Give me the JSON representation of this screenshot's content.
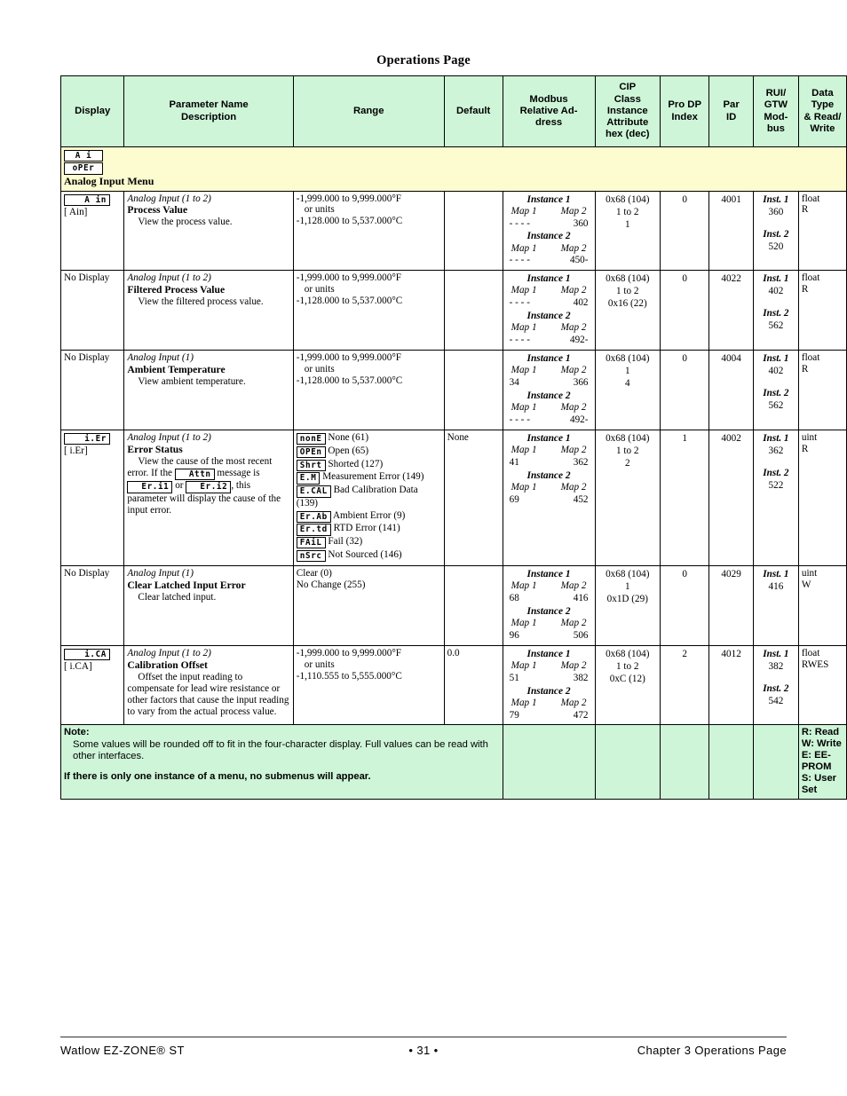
{
  "page_heading": "Operations Page",
  "table": {
    "headers": [
      "Display",
      "Parameter Name\nDescription",
      "Range",
      "Default",
      "Modbus\nRelative Address",
      "CIP\nClass\nInstance\nAttribute\nhex (dec)",
      "Pro DP\nIndex",
      "Par\nID",
      "RUI/\nGTW\nModbus",
      "Data\nType\n& Read/\nWrite"
    ],
    "header_parts": {
      "display": "Display",
      "param_1": "Parameter Name",
      "param_2": "Description",
      "range": "Range",
      "default": "Default",
      "modbus_1": "Modbus",
      "modbus_2": "Relative Ad-",
      "modbus_3": "dress",
      "cip_1": "CIP",
      "cip_2": "Class",
      "cip_3": "Instance",
      "cip_4": "Attribute",
      "cip_5": "hex (dec)",
      "prodp_1": "Pro DP",
      "prodp_2": "Index",
      "parid_1": "Par",
      "parid_2": "ID",
      "rui_1": "RUI/",
      "rui_2": "GTW",
      "rui_3": "Mod-",
      "rui_4": "bus",
      "dtype_1": "Data",
      "dtype_2": "Type",
      "dtype_3": "& Read/",
      "dtype_4": "Write"
    },
    "menu_row": {
      "seg_top": "A i",
      "seg_bottom": "oPEr",
      "title": "Analog Input Menu"
    },
    "rows": [
      {
        "display": {
          "seg": "A in",
          "bracket": "[ Ain]",
          "no_display": null
        },
        "param": {
          "instance": "Analog Input (1 to 2)",
          "name": "Process Value",
          "description": "View the process value."
        },
        "range": {
          "lines": [
            "-1,999.000 to 9,999.000°F",
            "or units",
            "-1,128.000 to 5,537.000°C"
          ],
          "indent": [
            false,
            true,
            false
          ]
        },
        "default": "",
        "modbus": {
          "inst1_label": "Instance 1",
          "map_header": [
            "Map 1",
            "Map 2"
          ],
          "inst1_vals": [
            "- - - -",
            "360"
          ],
          "inst2_label": "Instance 2",
          "inst2_vals": [
            "- - - -",
            "450-"
          ]
        },
        "cip": [
          "0x68 (104)",
          "1 to 2",
          "1"
        ],
        "prodp": "0",
        "parid": "4001",
        "rui": {
          "inst1_label": "Inst. 1",
          "inst1_value": "360",
          "inst2_label": "Inst. 2",
          "inst2_value": "520"
        },
        "dtype": [
          "float",
          "R"
        ]
      },
      {
        "display": {
          "seg": null,
          "bracket": null,
          "no_display": "No Display"
        },
        "param": {
          "instance": "Analog Input (1 to 2)",
          "name": "Filtered Process Value",
          "description": "View the filtered process value."
        },
        "range": {
          "lines": [
            "-1,999.000 to 9,999.000°F",
            "or units",
            "-1,128.000 to 5,537.000°C"
          ],
          "indent": [
            false,
            true,
            false
          ]
        },
        "default": "",
        "modbus": {
          "inst1_label": "Instance 1",
          "map_header": [
            "Map 1",
            "Map 2"
          ],
          "inst1_vals": [
            "- - - -",
            "402"
          ],
          "inst2_label": "Instance 2",
          "inst2_vals": [
            "- - - -",
            "492-"
          ]
        },
        "cip": [
          "0x68 (104)",
          "1 to 2",
          "0x16 (22)"
        ],
        "prodp": "0",
        "parid": "4022",
        "rui": {
          "inst1_label": "Inst. 1",
          "inst1_value": "402",
          "inst2_label": "Inst. 2",
          "inst2_value": "562"
        },
        "dtype": [
          "float",
          "R"
        ]
      },
      {
        "display": {
          "seg": null,
          "bracket": null,
          "no_display": "No Display"
        },
        "param": {
          "instance": "Analog Input (1)",
          "name": "Ambient Temperature",
          "description": "View ambient temperature."
        },
        "range": {
          "lines": [
            "-1,999.000 to 9,999.000°F",
            "or units",
            "-1,128.000 to 5,537.000°C"
          ],
          "indent": [
            false,
            true,
            false
          ]
        },
        "default": "",
        "modbus": {
          "inst1_label": "Instance 1",
          "map_header": [
            "Map 1",
            "Map 2"
          ],
          "inst1_vals": [
            "34",
            "366"
          ],
          "inst2_label": "Instance 2",
          "inst2_vals": [
            "- - - -",
            "492-"
          ]
        },
        "cip": [
          "0x68 (104)",
          "1",
          "4"
        ],
        "prodp": "0",
        "parid": "4004",
        "rui": {
          "inst1_label": "Inst. 1",
          "inst1_value": "402",
          "inst2_label": "Inst. 2",
          "inst2_value": "562"
        },
        "dtype": [
          "float",
          "R"
        ]
      },
      {
        "display": {
          "seg": "i.Er",
          "bracket": "[ i.Er]",
          "no_display": null
        },
        "param": {
          "instance": "Analog Input (1 to 2)",
          "name": "Error Status",
          "description_parts": [
            {
              "t": "View the cause of the most recent error. If the "
            },
            {
              "seg": "Attn"
            },
            {
              "t": " message is "
            },
            {
              "seg": "Er.i1"
            },
            {
              "t": " or "
            },
            {
              "seg": "Er.i2"
            },
            {
              "t": ", this parameter will display the cause of the input error."
            }
          ]
        },
        "range_options": [
          {
            "seg": "nonE",
            "label": "None (61)"
          },
          {
            "seg": "OPEn",
            "label": "Open (65)"
          },
          {
            "seg": "Shrt",
            "label": "Shorted (127)"
          },
          {
            "seg": "E.M",
            "label": "Measurement Error (149)"
          },
          {
            "seg": "E.CAL",
            "label": "Bad Calibration Data (139)"
          },
          {
            "seg": "Er.Ab",
            "label": "Ambient Error (9)"
          },
          {
            "seg": "Er.td",
            "label": "RTD Error (141)"
          },
          {
            "seg": "FAiL",
            "label": "Fail (32)"
          },
          {
            "seg": "nSrc",
            "label": "Not Sourced (146)"
          }
        ],
        "default": "None",
        "modbus": {
          "inst1_label": "Instance 1",
          "map_header": [
            "Map 1",
            "Map 2"
          ],
          "inst1_vals": [
            "41",
            "362"
          ],
          "inst2_label": "Instance 2",
          "inst2_vals": [
            "69",
            "452"
          ]
        },
        "cip": [
          "0x68 (104)",
          "1 to 2",
          "2"
        ],
        "prodp": "1",
        "parid": "4002",
        "rui": {
          "inst1_label": "Inst. 1",
          "inst1_value": "362",
          "inst2_label": "Inst. 2",
          "inst2_value": "522"
        },
        "dtype": [
          "uint",
          "R"
        ]
      },
      {
        "display": {
          "seg": null,
          "bracket": null,
          "no_display": "No Display"
        },
        "param": {
          "instance": "Analog Input (1)",
          "name": "Clear Latched Input Error",
          "description": "Clear latched input."
        },
        "range": {
          "lines": [
            "Clear (0)",
            "No Change (255)"
          ],
          "indent": [
            false,
            false
          ]
        },
        "default": "",
        "modbus": {
          "inst1_label": "Instance 1",
          "map_header": [
            "Map 1",
            "Map 2"
          ],
          "inst1_vals": [
            "68",
            "416"
          ],
          "inst2_label": "Instance 2",
          "inst2_vals": [
            "96",
            "506"
          ]
        },
        "cip": [
          "0x68 (104)",
          "1",
          "0x1D (29)"
        ],
        "prodp": "0",
        "parid": "4029",
        "rui": {
          "inst1_label": "Inst. 1",
          "inst1_value": "416",
          "inst2_label": null,
          "inst2_value": null
        },
        "dtype": [
          "uint",
          "W"
        ]
      },
      {
        "display": {
          "seg": "i.CA",
          "bracket": "[ i.CA]",
          "no_display": null
        },
        "param": {
          "instance": "Analog Input (1 to 2)",
          "name": "Calibration Offset",
          "description": "Offset the input reading to compensate for lead wire resistance or other factors that cause the input reading to vary from the actual process value."
        },
        "range": {
          "lines": [
            "-1,999.000 to 9,999.000°F",
            "or units",
            "-1,110.555 to 5,555.000°C"
          ],
          "indent": [
            false,
            true,
            false
          ]
        },
        "default": "0.0",
        "modbus": {
          "inst1_label": "Instance 1",
          "map_header": [
            "Map 1",
            "Map 2"
          ],
          "inst1_vals": [
            "51",
            "382"
          ],
          "inst2_label": "Instance 2",
          "inst2_vals": [
            "79",
            "472"
          ]
        },
        "cip": [
          "0x68 (104)",
          "1 to 2",
          "0xC (12)"
        ],
        "prodp": "2",
        "parid": "4012",
        "rui": {
          "inst1_label": "Inst. 1",
          "inst1_value": "382",
          "inst2_label": "Inst. 2",
          "inst2_value": "542"
        },
        "dtype": [
          "float",
          "RWES"
        ]
      }
    ],
    "note": {
      "title": "Note:",
      "body": "Some values will be rounded off to fit in the four-character display. Full values can be read with other interfaces.",
      "footer": "If there is only one instance of a menu, no submenus will appear."
    },
    "legend": [
      "R: Read",
      "W: Write",
      "E: EE-PROM",
      "S: User Set"
    ]
  },
  "footer": {
    "left": "Watlow EZ-ZONE® ST",
    "page_number": "• 31 •",
    "right": "Chapter 3 Operations Page"
  }
}
